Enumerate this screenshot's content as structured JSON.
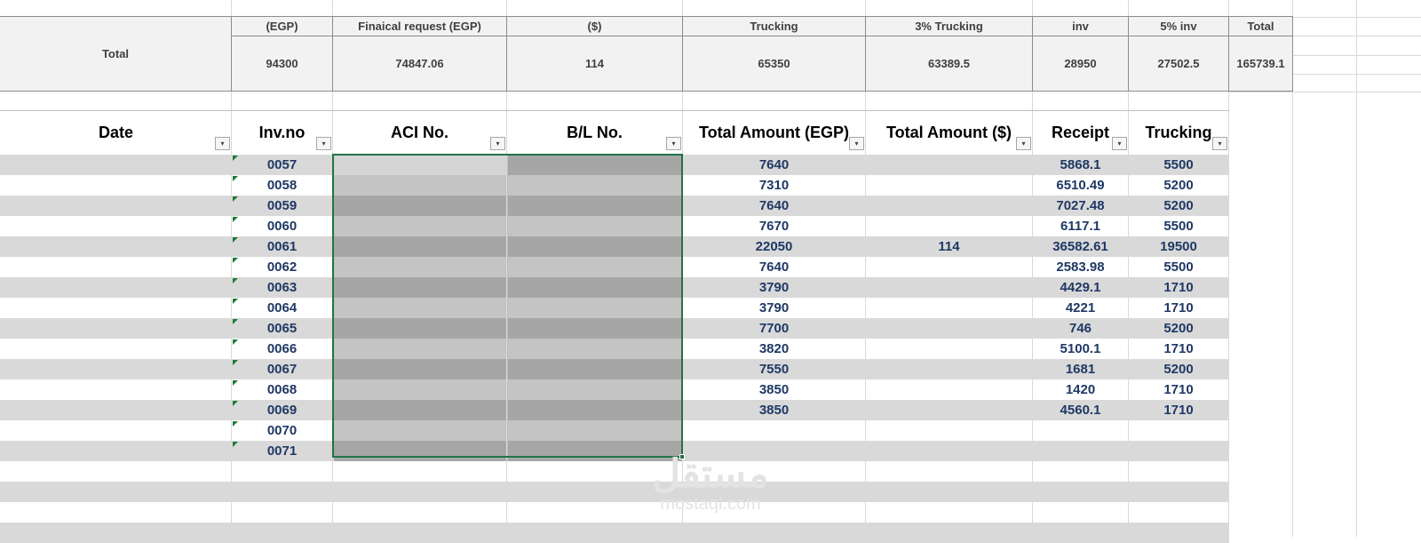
{
  "summary": {
    "row_label": "Total",
    "columns": [
      {
        "header": "(EGP)",
        "value": "94300"
      },
      {
        "header": "Finaical request (EGP)",
        "value": "74847.06"
      },
      {
        "header": "($)",
        "value": "114"
      },
      {
        "header": "Trucking",
        "value": "65350"
      },
      {
        "header": "3% Trucking",
        "value": "63389.5"
      },
      {
        "header": "inv",
        "value": "28950"
      },
      {
        "header": "5% inv",
        "value": "27502.5"
      },
      {
        "header": "Total",
        "value": "165739.1"
      }
    ]
  },
  "table": {
    "headers": [
      "Date",
      "Inv.no",
      "ACI No.",
      "B/L No.",
      "Total Amount (EGP)",
      "Total Amount ($)",
      "Receipt",
      "Trucking"
    ],
    "filter_glyph": "▾",
    "rows": [
      {
        "inv_no": "0057",
        "total_egp": "7640",
        "total_usd": "",
        "receipt": "5868.1",
        "trucking": "5500"
      },
      {
        "inv_no": "0058",
        "total_egp": "7310",
        "total_usd": "",
        "receipt": "6510.49",
        "trucking": "5200"
      },
      {
        "inv_no": "0059",
        "total_egp": "7640",
        "total_usd": "",
        "receipt": "7027.48",
        "trucking": "5200"
      },
      {
        "inv_no": "0060",
        "total_egp": "7670",
        "total_usd": "",
        "receipt": "6117.1",
        "trucking": "5500"
      },
      {
        "inv_no": "0061",
        "total_egp": "22050",
        "total_usd": "114",
        "receipt": "36582.61",
        "trucking": "19500"
      },
      {
        "inv_no": "0062",
        "total_egp": "7640",
        "total_usd": "",
        "receipt": "2583.98",
        "trucking": "5500"
      },
      {
        "inv_no": "0063",
        "total_egp": "3790",
        "total_usd": "",
        "receipt": "4429.1",
        "trucking": "1710"
      },
      {
        "inv_no": "0064",
        "total_egp": "3790",
        "total_usd": "",
        "receipt": "4221",
        "trucking": "1710"
      },
      {
        "inv_no": "0065",
        "total_egp": "7700",
        "total_usd": "",
        "receipt": "746",
        "trucking": "5200"
      },
      {
        "inv_no": "0066",
        "total_egp": "3820",
        "total_usd": "",
        "receipt": "5100.1",
        "trucking": "1710"
      },
      {
        "inv_no": "0067",
        "total_egp": "7550",
        "total_usd": "",
        "receipt": "1681",
        "trucking": "5200"
      },
      {
        "inv_no": "0068",
        "total_egp": "3850",
        "total_usd": "",
        "receipt": "1420",
        "trucking": "1710"
      },
      {
        "inv_no": "0069",
        "total_egp": "3850",
        "total_usd": "",
        "receipt": "4560.1",
        "trucking": "1710"
      },
      {
        "inv_no": "0070",
        "total_egp": "",
        "total_usd": "",
        "receipt": "",
        "trucking": ""
      },
      {
        "inv_no": "0071",
        "total_egp": "",
        "total_usd": "",
        "receipt": "",
        "trucking": ""
      }
    ]
  },
  "watermark": {
    "arabic": "مستقل",
    "latin": "mostaql.com"
  },
  "colors": {
    "band_gray": "#d9d9d9",
    "number_navy": "#1f3864",
    "selection_green": "#217346",
    "redact_light": "#c4c4c4",
    "redact_dark": "#a6a6a6"
  }
}
